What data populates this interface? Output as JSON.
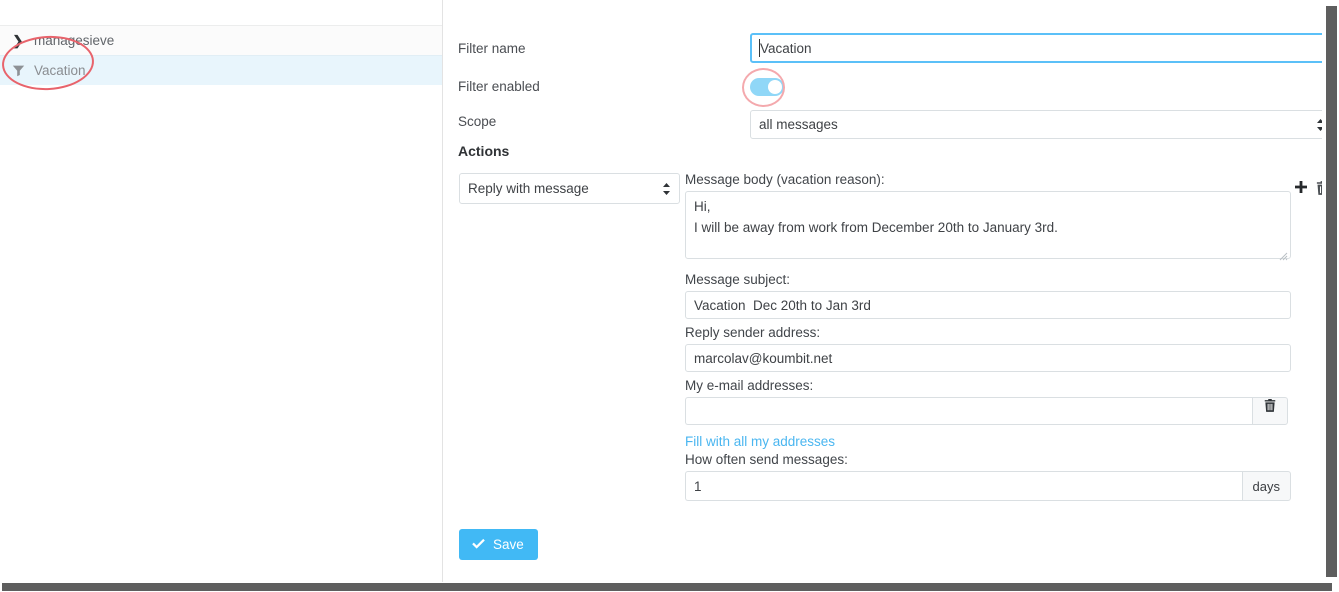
{
  "sidebar": {
    "items": [
      {
        "label": "managesieve",
        "icon": "chevron-right-icon",
        "type": "folder"
      },
      {
        "label": "Vacation",
        "icon": "funnel-filter-icon",
        "type": "filter",
        "selected": true
      }
    ]
  },
  "form": {
    "filter_name": {
      "label": "Filter name",
      "value": "Vacation",
      "placeholder": ""
    },
    "filter_enabled": {
      "label": "Filter enabled",
      "checked": true
    },
    "scope": {
      "label": "Scope",
      "value": "all messages",
      "options": [
        "all messages"
      ]
    },
    "actions_heading": "Actions",
    "action": {
      "type": {
        "value": "Reply with message",
        "options": [
          "Reply with message"
        ]
      },
      "add_icon": "plus-icon",
      "delete_icon": "trash-icon",
      "message_body": {
        "label": "Message body (vacation reason):",
        "value": "Hi,\nI will be away from work from December 20th to January 3rd.",
        "placeholder": ""
      },
      "message_subject": {
        "label": "Message subject:",
        "value": "Vacation  Dec 20th to Jan 3rd",
        "placeholder": ""
      },
      "reply_sender_address": {
        "label": "Reply sender address:",
        "value": "marcolav@koumbit.net",
        "placeholder": ""
      },
      "my_email_addresses": {
        "label": "My e-mail addresses:",
        "value": "",
        "placeholder": "",
        "delete_icon": "trash-icon"
      },
      "fill_addresses_link": "Fill with all my addresses",
      "how_often": {
        "label": "How often send messages:",
        "value": "1",
        "placeholder": "",
        "suffix": "days"
      }
    }
  },
  "save_button": {
    "label": "Save",
    "icon": "check-icon"
  },
  "colors": {
    "accent": "#41b9f5",
    "link": "#4ab6f0",
    "selected_row": "#e8f5fc",
    "toggle_on": "#90d7f7",
    "annotation": "#e8636b",
    "scrollbar": "#5e5e5e"
  }
}
